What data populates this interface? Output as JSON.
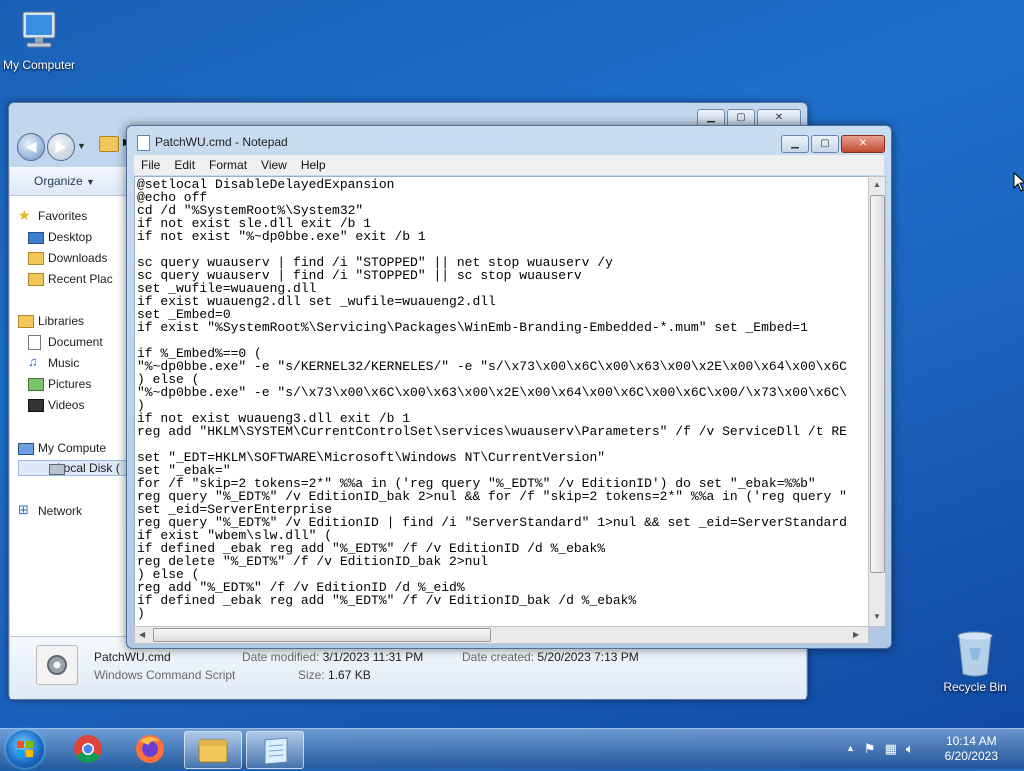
{
  "desktop": {
    "my_computer_label": "My Computer",
    "recycle_bin_label": "Recycle Bin"
  },
  "explorer": {
    "organize_label": "Organize",
    "nav": {
      "favorites": "Favorites",
      "desktop": "Desktop",
      "downloads": "Downloads",
      "recent_places": "Recent Plac",
      "libraries": "Libraries",
      "documents": "Document",
      "music": "Music",
      "pictures": "Pictures",
      "videos": "Videos",
      "my_computer": "My Compute",
      "local_disk": "Local Disk (",
      "network": "Network"
    },
    "status": {
      "file_name": "PatchWU.cmd",
      "file_type": "Windows Command Script",
      "date_modified_label": "Date modified:",
      "date_modified": "3/1/2023 11:31 PM",
      "date_created_label": "Date created:",
      "date_created": "5/20/2023 7:13 PM",
      "size_label": "Size:",
      "size": "1.67 KB"
    }
  },
  "notepad": {
    "title": "PatchWU.cmd - Notepad",
    "menu": [
      "File",
      "Edit",
      "Format",
      "View",
      "Help"
    ],
    "content": "@setlocal DisableDelayedExpansion\n@echo off\ncd /d \"%SystemRoot%\\System32\"\nif not exist sle.dll exit /b 1\nif not exist \"%~dp0bbe.exe\" exit /b 1\n\nsc query wuauserv | find /i \"STOPPED\" || net stop wuauserv /y\nsc query wuauserv | find /i \"STOPPED\" || sc stop wuauserv\nset _wufile=wuaueng.dll\nif exist wuaueng2.dll set _wufile=wuaueng2.dll\nset _Embed=0\nif exist \"%SystemRoot%\\Servicing\\Packages\\WinEmb-Branding-Embedded-*.mum\" set _Embed=1\n\nif %_Embed%==0 (\n\"%~dp0bbe.exe\" -e \"s/KERNEL32/KERNELES/\" -e \"s/\\x73\\x00\\x6C\\x00\\x63\\x00\\x2E\\x00\\x64\\x00\\x6C\n) else (\n\"%~dp0bbe.exe\" -e \"s/\\x73\\x00\\x6C\\x00\\x63\\x00\\x2E\\x00\\x64\\x00\\x6C\\x00\\x6C\\x00/\\x73\\x00\\x6C\\\n)\nif not exist wuaueng3.dll exit /b 1\nreg add \"HKLM\\SYSTEM\\CurrentControlSet\\services\\wuauserv\\Parameters\" /f /v ServiceDll /t RE\n\nset \"_EDT=HKLM\\SOFTWARE\\Microsoft\\Windows NT\\CurrentVersion\"\nset \"_ebak=\"\nfor /f \"skip=2 tokens=2*\" %%a in ('reg query \"%_EDT%\" /v EditionID') do set \"_ebak=%%b\"\nreg query \"%_EDT%\" /v EditionID_bak 2>nul && for /f \"skip=2 tokens=2*\" %%a in ('reg query \"\nset _eid=ServerEnterprise\nreg query \"%_EDT%\" /v EditionID | find /i \"ServerStandard\" 1>nul && set _eid=ServerStandard\nif exist \"wbem\\slw.dll\" (\nif defined _ebak reg add \"%_EDT%\" /f /v EditionID /d %_ebak%\nreg delete \"%_EDT%\" /f /v EditionID_bak 2>nul\n) else (\nreg add \"%_EDT%\" /f /v EditionID /d %_eid%\nif defined _ebak reg add \"%_EDT%\" /f /v EditionID_bak /d %_ebak%\n)"
  },
  "taskbar": {
    "time": "10:14 AM",
    "date": "6/20/2023"
  },
  "colors": {
    "desktop_blue": "#1e6fcc",
    "window_frame": "#aec8e6",
    "close_red": "#c24a2f"
  }
}
